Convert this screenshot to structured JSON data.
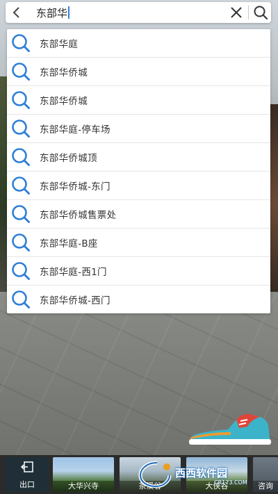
{
  "search": {
    "query": "东部华",
    "back_icon": "chevron-left-icon",
    "clear_icon": "close-icon",
    "search_icon": "search-icon"
  },
  "suggestions": [
    {
      "label": "东部华庭"
    },
    {
      "label": "东部华侨城"
    },
    {
      "label": "东部华侨城"
    },
    {
      "label": "东部华庭-停车场"
    },
    {
      "label": "东部华侨城顶"
    },
    {
      "label": "东部华侨城-东门"
    },
    {
      "label": "东部华侨城售票处"
    },
    {
      "label": "东部华庭-B座"
    },
    {
      "label": "东部华庭-西1门"
    },
    {
      "label": "东部华侨城-西门"
    }
  ],
  "thumbnails": {
    "exit_label": "出口",
    "items": [
      {
        "label": "大华兴寺"
      },
      {
        "label": "茶溪谷"
      },
      {
        "label": "大侠谷"
      },
      {
        "label": "咨询"
      }
    ]
  },
  "watermark": {
    "text": "西西软件园",
    "sub": "CR173.COM"
  },
  "colors": {
    "accent": "#2f7fd6",
    "shoe_blue": "#3bb4c9",
    "shoe_orange": "#f29a2e",
    "shoe_red": "#e0453a"
  }
}
